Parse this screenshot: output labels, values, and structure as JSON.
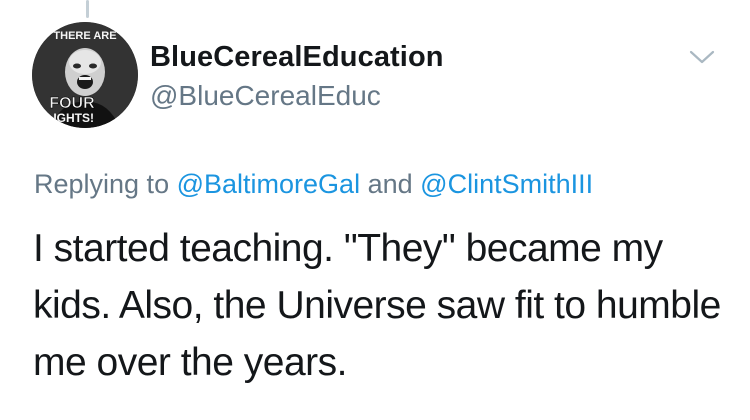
{
  "tweet": {
    "author": {
      "display_name": "BlueCerealEducation",
      "handle": "@BlueCerealEduc",
      "avatar": {
        "top_text": "THERE ARE",
        "mid_text": "FOUR",
        "bottom_text": "LIGHTS!"
      }
    },
    "reply": {
      "prefix": "Replying to",
      "mention_1": "@BaltimoreGal",
      "conjunction": "and",
      "mention_2": "@ClintSmithIII"
    },
    "text": "I started teaching. \"They\" became my kids. Also, the Universe saw fit to humble me over the years.",
    "icons": {
      "menu": "chevron-down-icon"
    },
    "colors": {
      "link": "#1b95e0",
      "secondary_text": "#657786",
      "primary_text": "#14171a"
    }
  }
}
